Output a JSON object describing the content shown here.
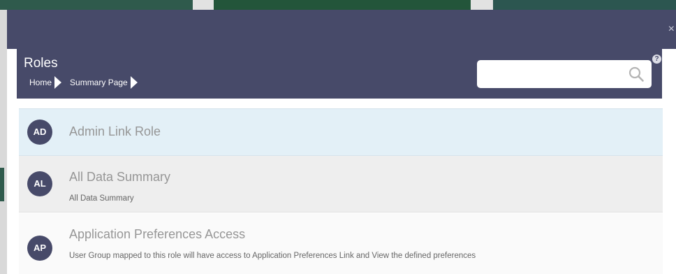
{
  "dialog": {
    "close_label": "×"
  },
  "header": {
    "title": "Roles",
    "breadcrumb": [
      {
        "label": "Home"
      },
      {
        "label": "Summary Page"
      }
    ],
    "search": {
      "value": "",
      "placeholder": ""
    },
    "help_label": "?"
  },
  "roles": [
    {
      "initials": "AD",
      "name": "Admin Link Role",
      "description": ""
    },
    {
      "initials": "AL",
      "name": "All Data Summary",
      "description": "All Data Summary"
    },
    {
      "initials": "AP",
      "name": "Application Preferences Access",
      "description": "User Group mapped to this role will have access to Application Preferences Link and View the defined preferences"
    }
  ],
  "icons": {
    "search": "search-icon",
    "help": "help-icon",
    "close": "close-icon",
    "breadcrumb_separator": "chevron-right-icon"
  },
  "colors": {
    "header_bg": "#474a69",
    "avatar_bg": "#474a69",
    "selected_row_bg": "#e3f0f7"
  }
}
